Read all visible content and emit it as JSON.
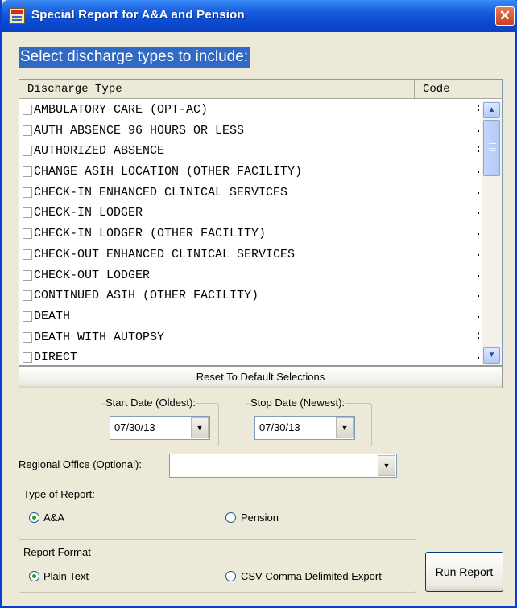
{
  "window": {
    "title": "Special Report for A&A and Pension",
    "close_symbol": "✕"
  },
  "instruction": "Select discharge types to include:",
  "list": {
    "headers": {
      "type": "Discharge Type",
      "code": "Code"
    },
    "rows": [
      {
        "label": "AMBULATORY CARE (OPT-AC)",
        "code": ":"
      },
      {
        "label": "AUTH ABSENCE 96 HOURS OR LESS",
        "code": "."
      },
      {
        "label": "AUTHORIZED ABSENCE",
        "code": ":"
      },
      {
        "label": "CHANGE ASIH LOCATION (OTHER FACILITY)",
        "code": "."
      },
      {
        "label": "CHECK-IN ENHANCED CLINICAL SERVICES",
        "code": "."
      },
      {
        "label": "CHECK-IN LODGER",
        "code": "."
      },
      {
        "label": "CHECK-IN LODGER (OTHER FACILITY)",
        "code": "."
      },
      {
        "label": "CHECK-OUT ENHANCED CLINICAL SERVICES",
        "code": "."
      },
      {
        "label": "CHECK-OUT LODGER",
        "code": "."
      },
      {
        "label": "CONTINUED ASIH (OTHER FACILITY)",
        "code": "."
      },
      {
        "label": "DEATH",
        "code": "."
      },
      {
        "label": "DEATH WITH AUTOPSY",
        "code": ":"
      },
      {
        "label": "DIRECT",
        "code": "."
      }
    ]
  },
  "reset_button": "Reset To Default Selections",
  "start_date": {
    "label": "Start Date (Oldest):",
    "value": "07/30/13"
  },
  "stop_date": {
    "label": "Stop Date (Newest):",
    "value": "07/30/13"
  },
  "regional_office": {
    "label": "Regional Office (Optional):",
    "value": ""
  },
  "report_type": {
    "label": "Type of Report:",
    "options": [
      "A&A",
      "Pension"
    ],
    "selected": "A&A"
  },
  "report_format": {
    "label": "Report Format",
    "options": [
      "Plain Text",
      "CSV Comma Delimited Export"
    ],
    "selected": "Plain Text"
  },
  "run_button": "Run Report",
  "colors": {
    "title_bar": "#0a49d0",
    "selection": "#316ac5",
    "window_bg": "#ece9d8"
  }
}
